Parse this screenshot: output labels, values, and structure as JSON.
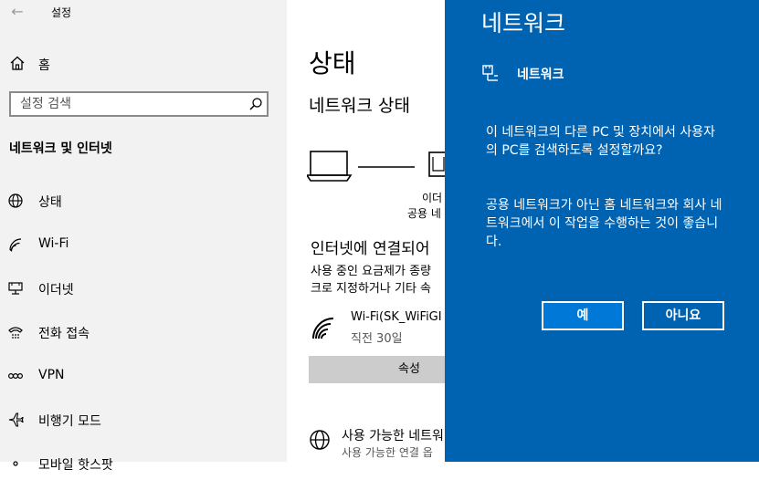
{
  "window": {
    "title": "설정",
    "back_icon": "arrow-left-icon"
  },
  "sidebar": {
    "home_label": "홈",
    "search_placeholder": "설정 검색",
    "section_title": "네트워크 및 인터넷",
    "items": [
      {
        "label": "상태",
        "icon": "globe-icon"
      },
      {
        "label": "Wi-Fi",
        "icon": "wifi-icon"
      },
      {
        "label": "이더넷",
        "icon": "ethernet-icon"
      },
      {
        "label": "전화 접속",
        "icon": "dialup-icon"
      },
      {
        "label": "VPN",
        "icon": "vpn-icon"
      },
      {
        "label": "비행기 모드",
        "icon": "airplane-icon"
      },
      {
        "label": "모바일 핫스팟",
        "icon": "hotspot-icon"
      }
    ]
  },
  "main": {
    "page_title": "상태",
    "network_status_title": "네트워크 상태",
    "diagram_label_1": "이더",
    "diagram_label_2": "공용 네",
    "connection_status": "인터넷에 연결되어",
    "connection_desc_line1": "사용 중인 요금제가 종량",
    "connection_desc_line2": "크로 지정하거나 기타 속",
    "wifi_name": "Wi-Fi(SK_WiFiGI",
    "wifi_time": "직전 30일",
    "properties_button": "속성",
    "available_title": "사용 가능한 네트워",
    "available_desc": "사용 가능한 연결 옵"
  },
  "flyout": {
    "title": "네트워크",
    "network_name": "네트워크",
    "paragraph1": "이 네트워크의 다른 PC 및 장치에서 사용자의 PC를 검색하도록 설정할까요?",
    "paragraph2": "공용 네트워크가 아닌 홈 네트워크와 회사 네트워크에서 이 작업을 수행하는 것이 좋습니다.",
    "yes_button": "예",
    "no_button": "아니요"
  },
  "colors": {
    "flyout_bg": "#0063b1",
    "accent": "#0078d7",
    "sidebar_bg": "#f2f2f2"
  }
}
